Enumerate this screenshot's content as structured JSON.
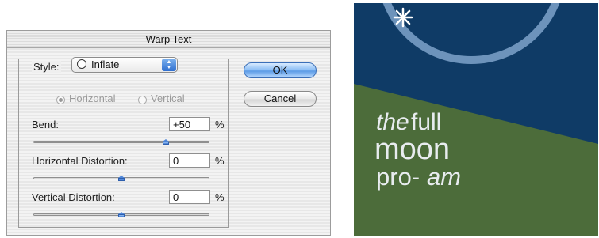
{
  "dialog": {
    "title": "Warp Text",
    "style_label": "Style:",
    "style_value": "Inflate",
    "orientation": {
      "horizontal_label": "Horizontal",
      "vertical_label": "Vertical",
      "selected": "Horizontal"
    },
    "bend": {
      "label": "Bend:",
      "value": "+50",
      "unit": "%",
      "slider_value": 50
    },
    "horizontal_distortion": {
      "label": "Horizontal Distortion:",
      "value": "0",
      "unit": "%",
      "slider_value": 0
    },
    "vertical_distortion": {
      "label": "Vertical Distortion:",
      "value": "0",
      "unit": "%",
      "slider_value": 0
    },
    "ok_label": "OK",
    "cancel_label": "Cancel"
  },
  "preview": {
    "text_lines": [
      "the",
      "full",
      "moon",
      "pro-",
      "am"
    ],
    "colors": {
      "sky": "#0f3b66",
      "ground": "#4c6c3a",
      "moon_ring": "#6d93bb",
      "text": "#e8ecef",
      "star": "#ffffff"
    }
  }
}
